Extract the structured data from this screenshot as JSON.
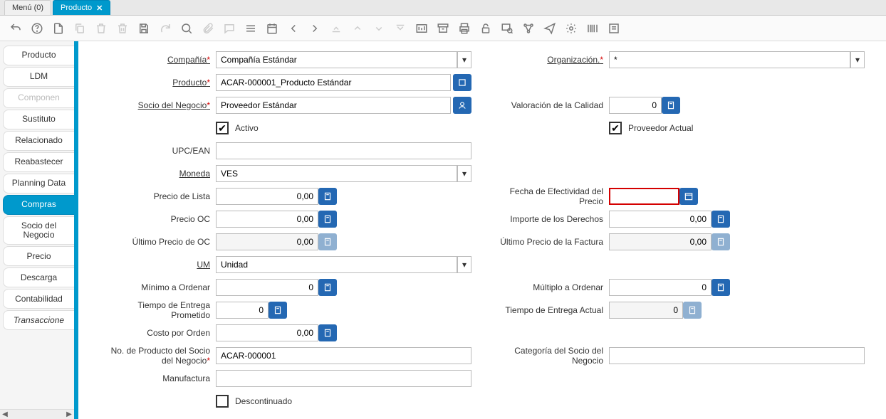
{
  "top_tabs": {
    "menu": "Menú (0)",
    "product": "Producto"
  },
  "side_tabs": [
    {
      "label": "Producto",
      "key": "producto"
    },
    {
      "label": "LDM",
      "key": "ldm"
    },
    {
      "label": "Componen",
      "key": "componentes",
      "disabled": true
    },
    {
      "label": "Sustituto",
      "key": "sustituto"
    },
    {
      "label": "Relacionado",
      "key": "relacionado"
    },
    {
      "label": "Reabastecer",
      "key": "reabastecer"
    },
    {
      "label": "Planning Data",
      "key": "planning"
    },
    {
      "label": "Compras",
      "key": "compras",
      "active": true
    },
    {
      "label": "Socio del Negocio",
      "key": "socio"
    },
    {
      "label": "Precio",
      "key": "precio"
    },
    {
      "label": "Descarga",
      "key": "descarga"
    },
    {
      "label": "Contabilidad",
      "key": "contabilidad"
    },
    {
      "label": "Transaccione",
      "key": "transacciones",
      "italic": true
    }
  ],
  "form": {
    "labels": {
      "compania": "Compañía",
      "organizacion": "Organización.",
      "producto": "Producto",
      "socio_negocio": "Socio del Negocio",
      "activo": "Activo",
      "valoracion_calidad": "Valoración de la Calidad",
      "proveedor_actual": "Proveedor Actual",
      "upc_ean": "UPC/EAN",
      "moneda": "Moneda",
      "precio_lista": "Precio de Lista",
      "fecha_efectividad": "Fecha de Efectividad del Precio",
      "precio_oc": "Precio OC",
      "importe_derechos": "Importe de los Derechos",
      "ultimo_precio_oc": "Último Precio de OC",
      "ultimo_precio_factura": "Último Precio de la Factura",
      "um": "UM",
      "minimo_ordenar": "Mínimo a Ordenar",
      "multiplo_ordenar": "Múltiplo a Ordenar",
      "tiempo_entrega_prometido": "Tiempo de Entrega Prometido",
      "tiempo_entrega_actual": "Tiempo de Entrega Actual",
      "costo_por_orden": "Costo por Orden",
      "no_producto_socio": "No. de Producto del Socio del Negocio",
      "categoria_socio": "Categoría del Socio del Negocio",
      "manufactura": "Manufactura",
      "descontinuado": "Descontinuado"
    },
    "values": {
      "compania": "Compañía Estándar",
      "organizacion": "*",
      "producto": "ACAR-000001_Producto Estándar",
      "socio_negocio": "Proveedor Estándar",
      "activo": true,
      "valoracion_calidad": "0",
      "proveedor_actual": true,
      "upc_ean": "",
      "moneda": "VES",
      "precio_lista": "0,00",
      "fecha_efectividad": "",
      "precio_oc": "0,00",
      "importe_derechos": "0,00",
      "ultimo_precio_oc": "0,00",
      "ultimo_precio_factura": "0,00",
      "um": "Unidad",
      "minimo_ordenar": "0",
      "multiplo_ordenar": "0",
      "tiempo_entrega_prometido": "0",
      "tiempo_entrega_actual": "0",
      "costo_por_orden": "0,00",
      "no_producto_socio": "ACAR-000001",
      "categoria_socio": "",
      "manufactura": "",
      "descontinuado": false
    }
  }
}
